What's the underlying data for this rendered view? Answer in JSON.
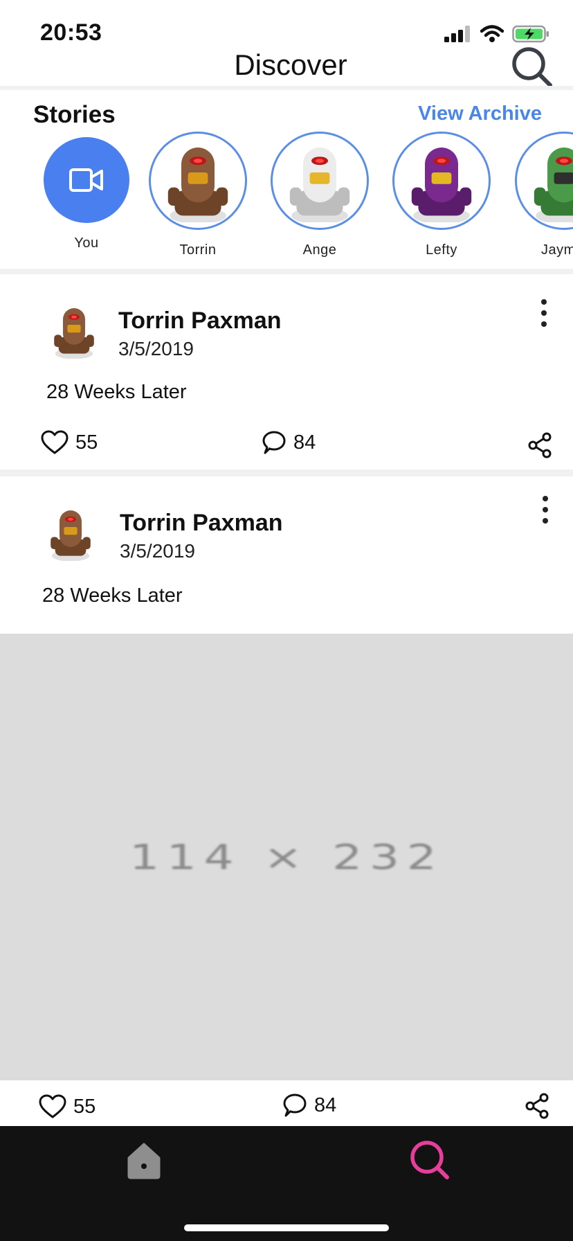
{
  "status_bar": {
    "time": "20:53",
    "icons": [
      "cellular-signal-icon",
      "wifi-icon",
      "battery-charging-icon"
    ],
    "battery_color": "#4cd964"
  },
  "header": {
    "title": "Discover",
    "search_icon": "search-icon"
  },
  "stories": {
    "title": "Stories",
    "view_archive_label": "View Archive",
    "accent_color": "#4a86e8",
    "items": [
      {
        "name": "You",
        "icon": "video-camera-icon"
      },
      {
        "name": "Torrin",
        "icon": "brown-robot-avatar"
      },
      {
        "name": "Ange",
        "icon": "white-robot-avatar"
      },
      {
        "name": "Lefty",
        "icon": "purple-robot-avatar"
      },
      {
        "name": "Jaym",
        "icon": "green-robot-avatar"
      }
    ]
  },
  "posts": [
    {
      "author": "Torrin Paxman",
      "date": "3/5/2019",
      "text": "28 Weeks Later",
      "likes": "55",
      "comments": "84"
    },
    {
      "author": "Torrin Paxman",
      "date": "3/5/2019",
      "text": "28 Weeks Later",
      "media_label": "114 × 232",
      "likes": "55",
      "comments": "84"
    }
  ],
  "tab_bar": {
    "items": [
      {
        "name": "home",
        "icon": "home-icon",
        "active": false
      },
      {
        "name": "discover",
        "icon": "search-icon",
        "active": true
      }
    ],
    "active_color": "#e83e9b",
    "inactive_color": "#8e8e8e"
  }
}
